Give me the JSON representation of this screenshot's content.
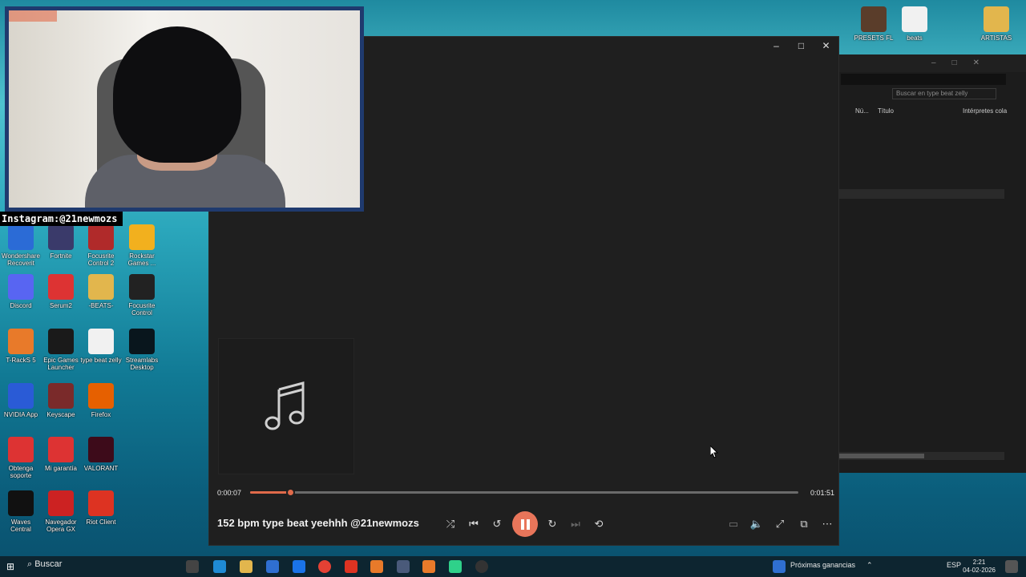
{
  "overlay": {
    "instagram": "Instagram:@21newmozs"
  },
  "desktop_icons": [
    {
      "label": "PRESETS FL",
      "icon": "folder-image-icon",
      "color": "#5a3d2a"
    },
    {
      "label": "beats",
      "icon": "audio-file-icon",
      "color": "#f1f1f1"
    },
    {
      "label": "ARTISTAS",
      "icon": "folder-icon",
      "color": "#e2b64d"
    },
    {
      "label": "Wondershare Recoverit",
      "icon": "recoverit-icon",
      "color": "#2b6bd6"
    },
    {
      "label": "Fortnite",
      "icon": "fortnite-icon",
      "color": "#3a3a6a"
    },
    {
      "label": "Focusrite Control 2",
      "icon": "focusrite-icon",
      "color": "#b02a2a"
    },
    {
      "label": "Rockstar Games ...",
      "icon": "rockstar-icon",
      "color": "#f2b01e"
    },
    {
      "label": "Discord",
      "icon": "discord-icon",
      "color": "#5865f2"
    },
    {
      "label": "Serum2",
      "icon": "serum-icon",
      "color": "#d33"
    },
    {
      "label": "-BEATS-",
      "icon": "folder-icon",
      "color": "#e2b64d"
    },
    {
      "label": "Focusrite Control",
      "icon": "focusrite-meter-icon",
      "color": "#222"
    },
    {
      "label": "T-RackS 5",
      "icon": "trackss-icon",
      "color": "#e87a2a"
    },
    {
      "label": "Epic Games Launcher",
      "icon": "epic-icon",
      "color": "#1a1a1a"
    },
    {
      "label": "type beat zelly",
      "icon": "audio-file-icon",
      "color": "#f1f1f1"
    },
    {
      "label": "Streamlabs Desktop",
      "icon": "streamlabs-icon",
      "color": "#09161d"
    },
    {
      "label": "NVIDIA App",
      "icon": "nvidia-icon",
      "color": "#2a5bd6"
    },
    {
      "label": "Keyscape",
      "icon": "keyscape-icon",
      "color": "#7a2a2a"
    },
    {
      "label": "Firefox",
      "icon": "firefox-icon",
      "color": "#e66000"
    },
    {
      "label": "Obtenga soporte",
      "icon": "support-icon",
      "color": "#d33"
    },
    {
      "label": "Mi garantía",
      "icon": "warranty-icon",
      "color": "#d33"
    },
    {
      "label": "VALORANT",
      "icon": "valorant-icon",
      "color": "#3d0b1a"
    },
    {
      "label": "Waves Central",
      "icon": "waves-icon",
      "color": "#111"
    },
    {
      "label": "Navegador Opera GX",
      "icon": "opera-gx-icon",
      "color": "#c22"
    },
    {
      "label": "Riot Client",
      "icon": "riot-icon",
      "color": "#d32"
    }
  ],
  "explorer": {
    "search_placeholder": "Buscar en type beat zelly",
    "columns": [
      "Nú...",
      "Título",
      "Intérpretes cola"
    ]
  },
  "player": {
    "elapsed": "0:00:07",
    "duration": "0:01:51",
    "progress": 0.075,
    "title": "152 bpm type beat yeehhh @21newmozs",
    "colors": {
      "accent": "#e8755a",
      "bg": "#1f1f1f"
    }
  },
  "taskbar": {
    "search": "Buscar",
    "news": "Próximas ganancias",
    "lang": "ESP",
    "time": "2:21",
    "date": "04-02-2026"
  }
}
